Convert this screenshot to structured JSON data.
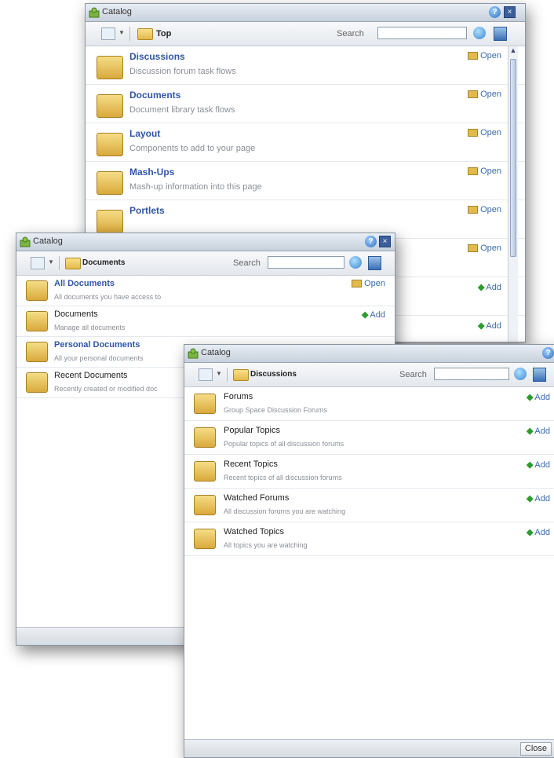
{
  "windows": {
    "top": {
      "title": "Catalog",
      "breadcrumb": "Top",
      "search_label": "Search",
      "search_value": "",
      "items": [
        {
          "name": "Discussions",
          "desc": "Discussion forum task flows",
          "action": "Open",
          "icon": "discussions-folder-icon"
        },
        {
          "name": "Documents",
          "desc": "Document library task flows",
          "action": "Open",
          "icon": "documents-folder-icon"
        },
        {
          "name": "Layout",
          "desc": "Components to add to your page",
          "action": "Open",
          "icon": "layout-folder-icon"
        },
        {
          "name": "Mash-Ups",
          "desc": "Mash-up information into this page",
          "action": "Open",
          "icon": "mashups-folder-icon"
        },
        {
          "name": "Portlets",
          "desc": "",
          "action": "Open",
          "icon": "portlets-folder-icon"
        },
        {
          "name": "",
          "desc": "",
          "action": "Open",
          "icon": ""
        },
        {
          "name": "",
          "desc": "",
          "action": "Add",
          "icon": ""
        },
        {
          "name": "",
          "desc": "",
          "action": "Add",
          "icon": ""
        }
      ]
    },
    "docs": {
      "title": "Catalog",
      "breadcrumb": "Documents",
      "search_label": "Search",
      "search_value": "",
      "items": [
        {
          "name": "All Documents",
          "desc": "All documents you have access to",
          "action": "Open",
          "bold": true
        },
        {
          "name": "Documents",
          "desc": "Manage all documents",
          "action": "Add",
          "bold": false
        },
        {
          "name": "Personal Documents",
          "desc": "All your personal documents",
          "action": "",
          "bold": true
        },
        {
          "name": "Recent Documents",
          "desc": "Recently created or modified doc",
          "action": "",
          "bold": false
        }
      ]
    },
    "disc": {
      "title": "Catalog",
      "breadcrumb": "Discussions",
      "search_label": "Search",
      "search_value": "",
      "close_label": "Close",
      "items": [
        {
          "name": "Forums",
          "desc": "Group Space Discussion Forums",
          "action": "Add"
        },
        {
          "name": "Popular Topics",
          "desc": "Popular topics of all discussion forums",
          "action": "Add"
        },
        {
          "name": "Recent Topics",
          "desc": "Recent topics of all discussion forums",
          "action": "Add"
        },
        {
          "name": "Watched Forums",
          "desc": "All discussion forums you are watching",
          "action": "Add"
        },
        {
          "name": "Watched Topics",
          "desc": "All topics you are watching",
          "action": "Add"
        }
      ]
    }
  },
  "colors": {
    "link": "#3056a6",
    "add": "#2f9b2f",
    "titlebar": "#c7d0dc"
  }
}
